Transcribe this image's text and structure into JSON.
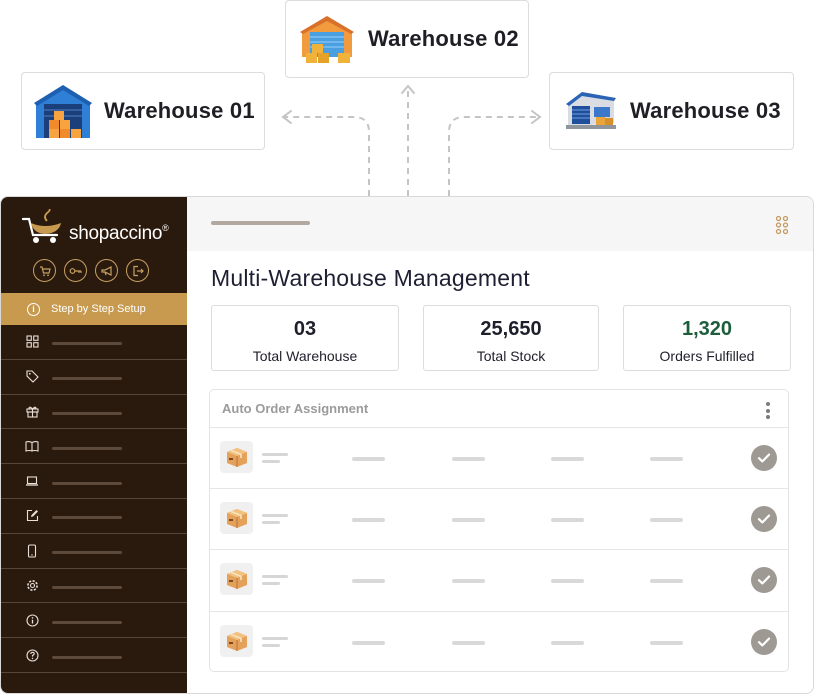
{
  "warehouses": [
    {
      "name": "Warehouse 01",
      "icon": "warehouse-blue-icon"
    },
    {
      "name": "Warehouse 02",
      "icon": "warehouse-orange-icon"
    },
    {
      "name": "Warehouse 03",
      "icon": "warehouse-building-icon"
    }
  ],
  "sidebar": {
    "brand": "shopaccino",
    "brand_mark": "®",
    "quick_icons": [
      "cart-icon",
      "key-icon",
      "megaphone-icon",
      "logout-icon"
    ],
    "setup_label": "Step by Step Setup",
    "nav_icons": [
      "grid-icon",
      "tag-icon",
      "gift-icon",
      "book-icon",
      "laptop-icon",
      "edit-icon",
      "mobile-icon",
      "gear-icon",
      "info-icon",
      "help-icon"
    ]
  },
  "main": {
    "title": "Multi-Warehouse Management",
    "stats": [
      {
        "value": "03",
        "label": "Total Warehouse"
      },
      {
        "value": "25,650",
        "label": "Total Stock"
      },
      {
        "value": "1,320",
        "label": "Orders Fulfilled"
      }
    ],
    "panel_title": "Auto Order Assignment",
    "order_rows": 4
  },
  "colors": {
    "sidebar_bg": "#2a1a0e",
    "accent_gold": "#c79a4f",
    "fulfilled_green": "#1d5d3c",
    "check_gray": "#9e9993"
  }
}
